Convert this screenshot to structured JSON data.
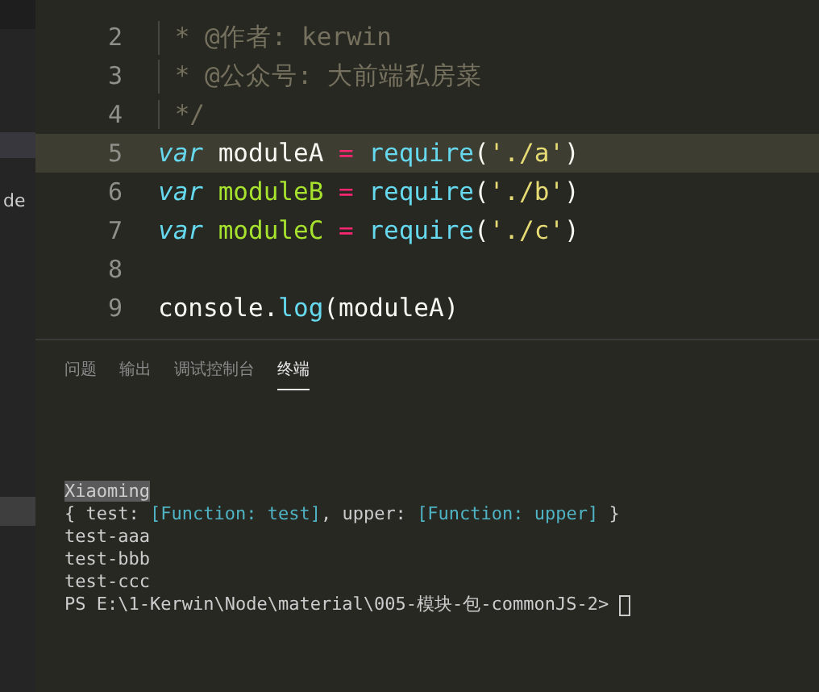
{
  "sidebar": {
    "text": "de"
  },
  "editor": {
    "lines": [
      {
        "number": "2",
        "current": false,
        "tokens": [
          {
            "kind": "comment",
            "text": " * @作者: kerwin"
          }
        ]
      },
      {
        "number": "3",
        "current": false,
        "tokens": [
          {
            "kind": "comment",
            "text": " * @公众号: 大前端私房菜"
          }
        ]
      },
      {
        "number": "4",
        "current": false,
        "tokens": [
          {
            "kind": "comment",
            "text": " */"
          }
        ]
      },
      {
        "number": "5",
        "current": true,
        "tokens": [
          {
            "kind": "keyword",
            "text": "var"
          },
          {
            "kind": "plain",
            "text": " moduleA "
          },
          {
            "kind": "operator",
            "text": "= "
          },
          {
            "kind": "function",
            "text": "require"
          },
          {
            "kind": "plain",
            "text": "("
          },
          {
            "kind": "string",
            "text": "'./a'"
          },
          {
            "kind": "plain",
            "text": ")"
          }
        ]
      },
      {
        "number": "6",
        "current": false,
        "tokens": [
          {
            "kind": "keyword",
            "text": "var "
          },
          {
            "kind": "definition",
            "text": "moduleB "
          },
          {
            "kind": "operator",
            "text": "= "
          },
          {
            "kind": "function",
            "text": "require"
          },
          {
            "kind": "plain",
            "text": "("
          },
          {
            "kind": "string",
            "text": "'./b'"
          },
          {
            "kind": "plain",
            "text": ")"
          }
        ]
      },
      {
        "number": "7",
        "current": false,
        "tokens": [
          {
            "kind": "keyword",
            "text": "var "
          },
          {
            "kind": "definition",
            "text": "moduleC "
          },
          {
            "kind": "operator",
            "text": "= "
          },
          {
            "kind": "function",
            "text": "require"
          },
          {
            "kind": "plain",
            "text": "("
          },
          {
            "kind": "string",
            "text": "'./c'"
          },
          {
            "kind": "plain",
            "text": ")"
          }
        ]
      },
      {
        "number": "8",
        "current": false
      },
      {
        "number": "9",
        "current": false,
        "tokens": [
          {
            "kind": "plain",
            "text": "console."
          },
          {
            "kind": "function",
            "text": "log"
          },
          {
            "kind": "plain",
            "text": "(moduleA)"
          }
        ]
      }
    ]
  },
  "panel": {
    "tabs": [
      {
        "label": "问题",
        "selected": false
      },
      {
        "label": "输出",
        "selected": false
      },
      {
        "label": "调试控制台",
        "selected": false
      },
      {
        "label": "终端",
        "selected": true
      }
    ],
    "terminal": [
      [
        {
          "kind": "highlighted",
          "text": "Xiaoming"
        }
      ],
      [
        {
          "kind": "plain",
          "text": "{ test: "
        },
        {
          "kind": "function",
          "text": "[Function: test]"
        },
        {
          "kind": "plain",
          "text": ", upper: "
        },
        {
          "kind": "function",
          "text": "[Function: upper]"
        },
        {
          "kind": "plain",
          "text": " }"
        }
      ],
      [
        {
          "kind": "plain",
          "text": "test-aaa"
        }
      ],
      [
        {
          "kind": "plain",
          "text": "test-bbb"
        }
      ],
      [
        {
          "kind": "plain",
          "text": "test-ccc"
        }
      ],
      [
        {
          "kind": "plain",
          "text": "PS E:\\1-Kerwin\\Node\\material\\005-模块-包-commonJS-2> "
        }
      ]
    ]
  }
}
